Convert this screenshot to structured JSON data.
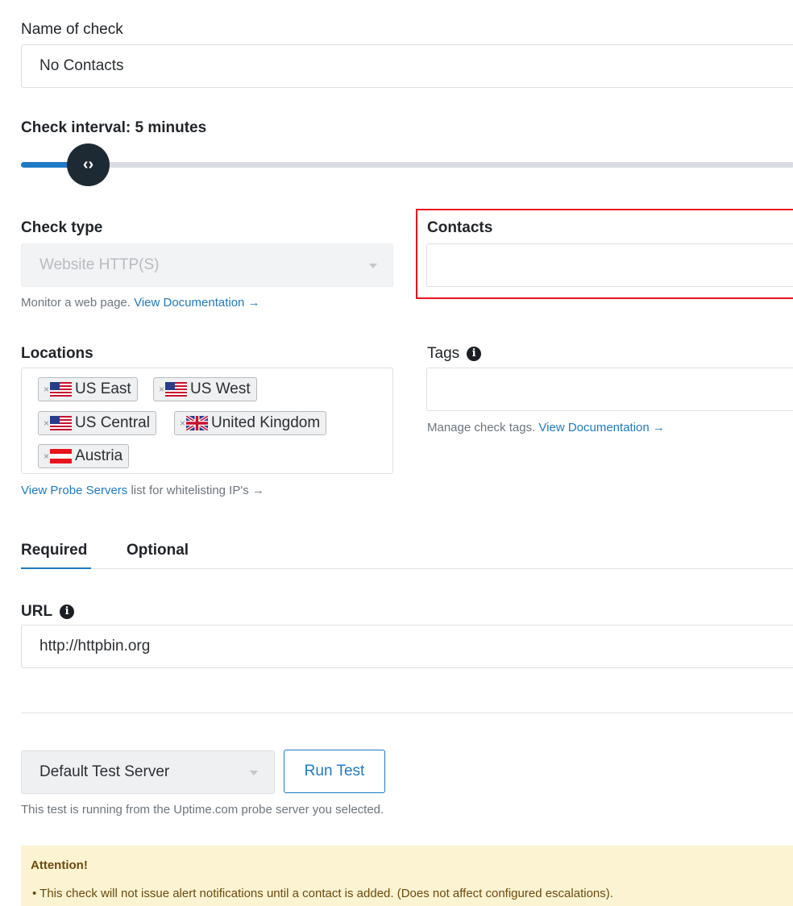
{
  "name_of_check": {
    "label": "Name of check",
    "value": "No Contacts"
  },
  "check_interval": {
    "label": "Check interval: 5 minutes",
    "knob_icon": "‹›",
    "level_fraction": 0.09
  },
  "check_type": {
    "label": "Check type",
    "selected": "Website HTTP(S)",
    "help_text": "Monitor a web page.",
    "help_link": "View Documentation →"
  },
  "contacts": {
    "label": "Contacts",
    "value": ""
  },
  "locations": {
    "label": "Locations",
    "chips": [
      {
        "remove": "×",
        "flag": "us",
        "label": "US East"
      },
      {
        "remove": "×",
        "flag": "us",
        "label": "US West"
      },
      {
        "remove": "×",
        "flag": "us",
        "label": "US Central"
      },
      {
        "remove": "×",
        "flag": "uk",
        "label": "United Kingdom"
      },
      {
        "remove": "×",
        "flag": "at",
        "label": "Austria"
      }
    ],
    "help_link": "View Probe Servers",
    "help_text": " list for whitelisting IP's →"
  },
  "tags": {
    "label": "Tags",
    "info_icon": "i",
    "value": "",
    "help_text": "Manage check tags.",
    "help_link": "View Documentation →"
  },
  "tabs": [
    {
      "label": "Required",
      "active": true
    },
    {
      "label": "Optional",
      "active": false
    }
  ],
  "url": {
    "label": "URL",
    "info_icon": "i",
    "value": "http://httpbin.org"
  },
  "test": {
    "server_selected": "Default Test Server",
    "run_label": "Run Test",
    "help_text": "This test is running from the Uptime.com probe server you selected."
  },
  "alert": {
    "title": "Attention!",
    "items": [
      "This check will not issue alert notifications until a contact is added. (Does not affect configured escalations)."
    ]
  },
  "colors": {
    "accent": "#1f7ac4",
    "highlight_border": "#e8141c",
    "alert_bg": "#fcf3d3"
  }
}
